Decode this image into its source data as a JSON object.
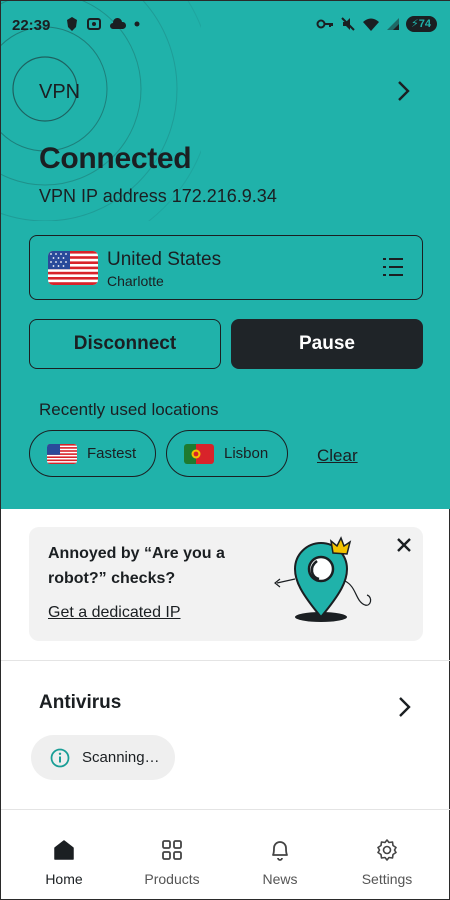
{
  "status_bar": {
    "time": "22:39",
    "battery": "74",
    "left_icons": [
      "shield-icon",
      "scan-icon",
      "cloud-icon",
      "dot-icon"
    ],
    "right_icons": [
      "key-icon",
      "mute-icon",
      "wifi-icon",
      "signal-icon",
      "battery-icon"
    ]
  },
  "header": {
    "title": "VPN",
    "status": "Connected",
    "ip_line": "VPN IP address 172.216.9.34"
  },
  "location": {
    "country": "United States",
    "city": "Charlotte",
    "flag": "us-flag-icon",
    "menu_icon": "list-icon"
  },
  "actions": {
    "disconnect_label": "Disconnect",
    "pause_label": "Pause"
  },
  "recent": {
    "label": "Recently used locations",
    "items": [
      {
        "label": "Fastest",
        "flag": "us-flag-icon"
      },
      {
        "label": "Lisbon",
        "flag": "portugal-flag-icon"
      }
    ],
    "clear_label": "Clear"
  },
  "promo": {
    "text": "Annoyed by “Are you a robot?” checks?",
    "link": "Get a dedicated IP"
  },
  "antivirus": {
    "title": "Antivirus",
    "status": "Scanning…",
    "status_icon": "info-icon"
  },
  "nav": {
    "items": [
      {
        "label": "Home",
        "icon": "home-icon",
        "active": true
      },
      {
        "label": "Products",
        "icon": "grid-icon",
        "active": false
      },
      {
        "label": "News",
        "icon": "bell-icon",
        "active": false
      },
      {
        "label": "Settings",
        "icon": "gear-icon",
        "active": false
      }
    ]
  },
  "colors": {
    "accent": "#20b2aa",
    "dark": "#1f2428",
    "text": "#1b1f22",
    "card_bg": "#f2f2f2"
  }
}
